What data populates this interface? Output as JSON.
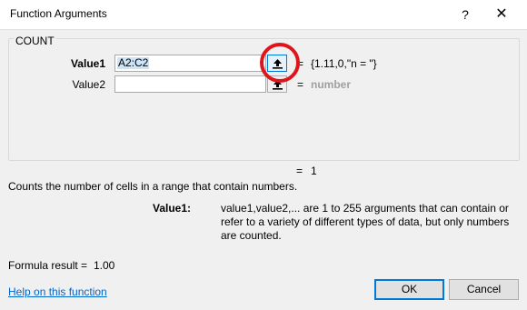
{
  "window": {
    "title": "Function Arguments",
    "help_glyph": "?",
    "close_glyph": "✕"
  },
  "function": {
    "name": "COUNT",
    "arguments": [
      {
        "label": "Value1",
        "value": "A2:C2",
        "result": "{1.11,0,\"n = \"}"
      },
      {
        "label": "Value2",
        "value": "",
        "result": "number"
      }
    ],
    "equals": "=",
    "total_result": "1",
    "description": "Counts the number of cells in a range that contain numbers.",
    "arg_help_label": "Value1:",
    "arg_help_text": "value1,value2,... are 1 to 255 arguments that can contain or refer to a variety of different types of data, but only numbers are counted."
  },
  "formula_result": {
    "label": "Formula result =",
    "value": "1.00"
  },
  "help_link": "Help on this function",
  "buttons": {
    "ok": "OK",
    "cancel": "Cancel"
  },
  "icons": {
    "collapse": "collapse-dialog-icon"
  },
  "colors": {
    "highlight": "#e0151b",
    "link": "#0066cc",
    "accent": "#0078d7"
  }
}
